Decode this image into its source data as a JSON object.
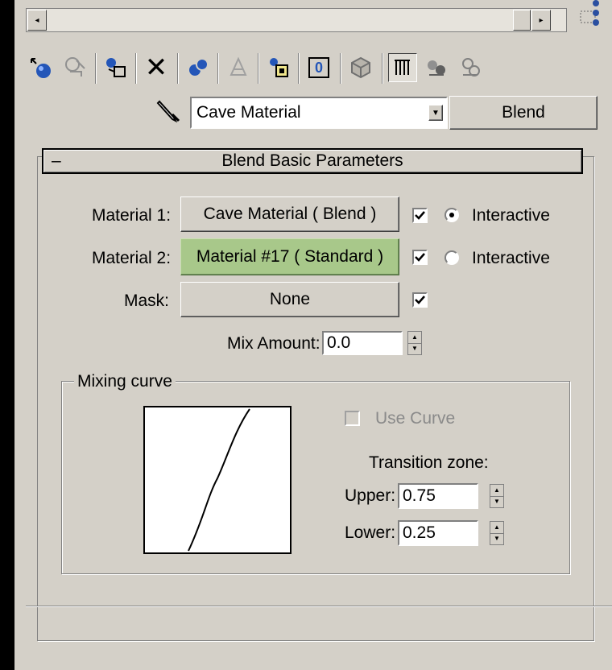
{
  "scrollbar": {
    "left_arrow": "◂",
    "right_arrow": "▸"
  },
  "toolbar": {
    "icons": [
      "get-material-icon",
      "put-to-scene-icon",
      "assign-to-selection-icon",
      "reset-map-icon",
      "make-unique-icon",
      "put-to-library-icon",
      "material-effects-channel-icon",
      "show-map-icon",
      "show-end-result-icon",
      "go-to-parent-icon",
      "go-forward-sibling-icon"
    ],
    "delete_glyph": "✕",
    "channel_label": "0"
  },
  "material": {
    "name": "Cave Material",
    "type_button": "Blend"
  },
  "rollout": {
    "collapse_symbol": "–",
    "title": "Blend Basic Parameters"
  },
  "params": {
    "material1": {
      "label": "Material 1:",
      "button": "Cave Material  ( Blend )",
      "enabled": true,
      "interactive_label": "Interactive",
      "interactive_selected": true
    },
    "material2": {
      "label": "Material 2:",
      "button": "Material #17  ( Standard )",
      "enabled": true,
      "interactive_label": "Interactive",
      "interactive_selected": false
    },
    "mask": {
      "label": "Mask:",
      "button": "None",
      "enabled": true
    },
    "mix_amount": {
      "label": "Mix Amount:",
      "value": "0.0"
    }
  },
  "mixing_curve": {
    "group_label": "Mixing curve",
    "use_curve_label": "Use Curve",
    "use_curve_checked": false,
    "transition_zone_label": "Transition zone:",
    "upper_label": "Upper:",
    "upper_value": "0.75",
    "lower_label": "Lower:",
    "lower_value": "0.25"
  },
  "colors": {
    "panel": "#d4d0c8",
    "highlight": "#a8c88a",
    "disabled_text": "#8a8a8a"
  }
}
